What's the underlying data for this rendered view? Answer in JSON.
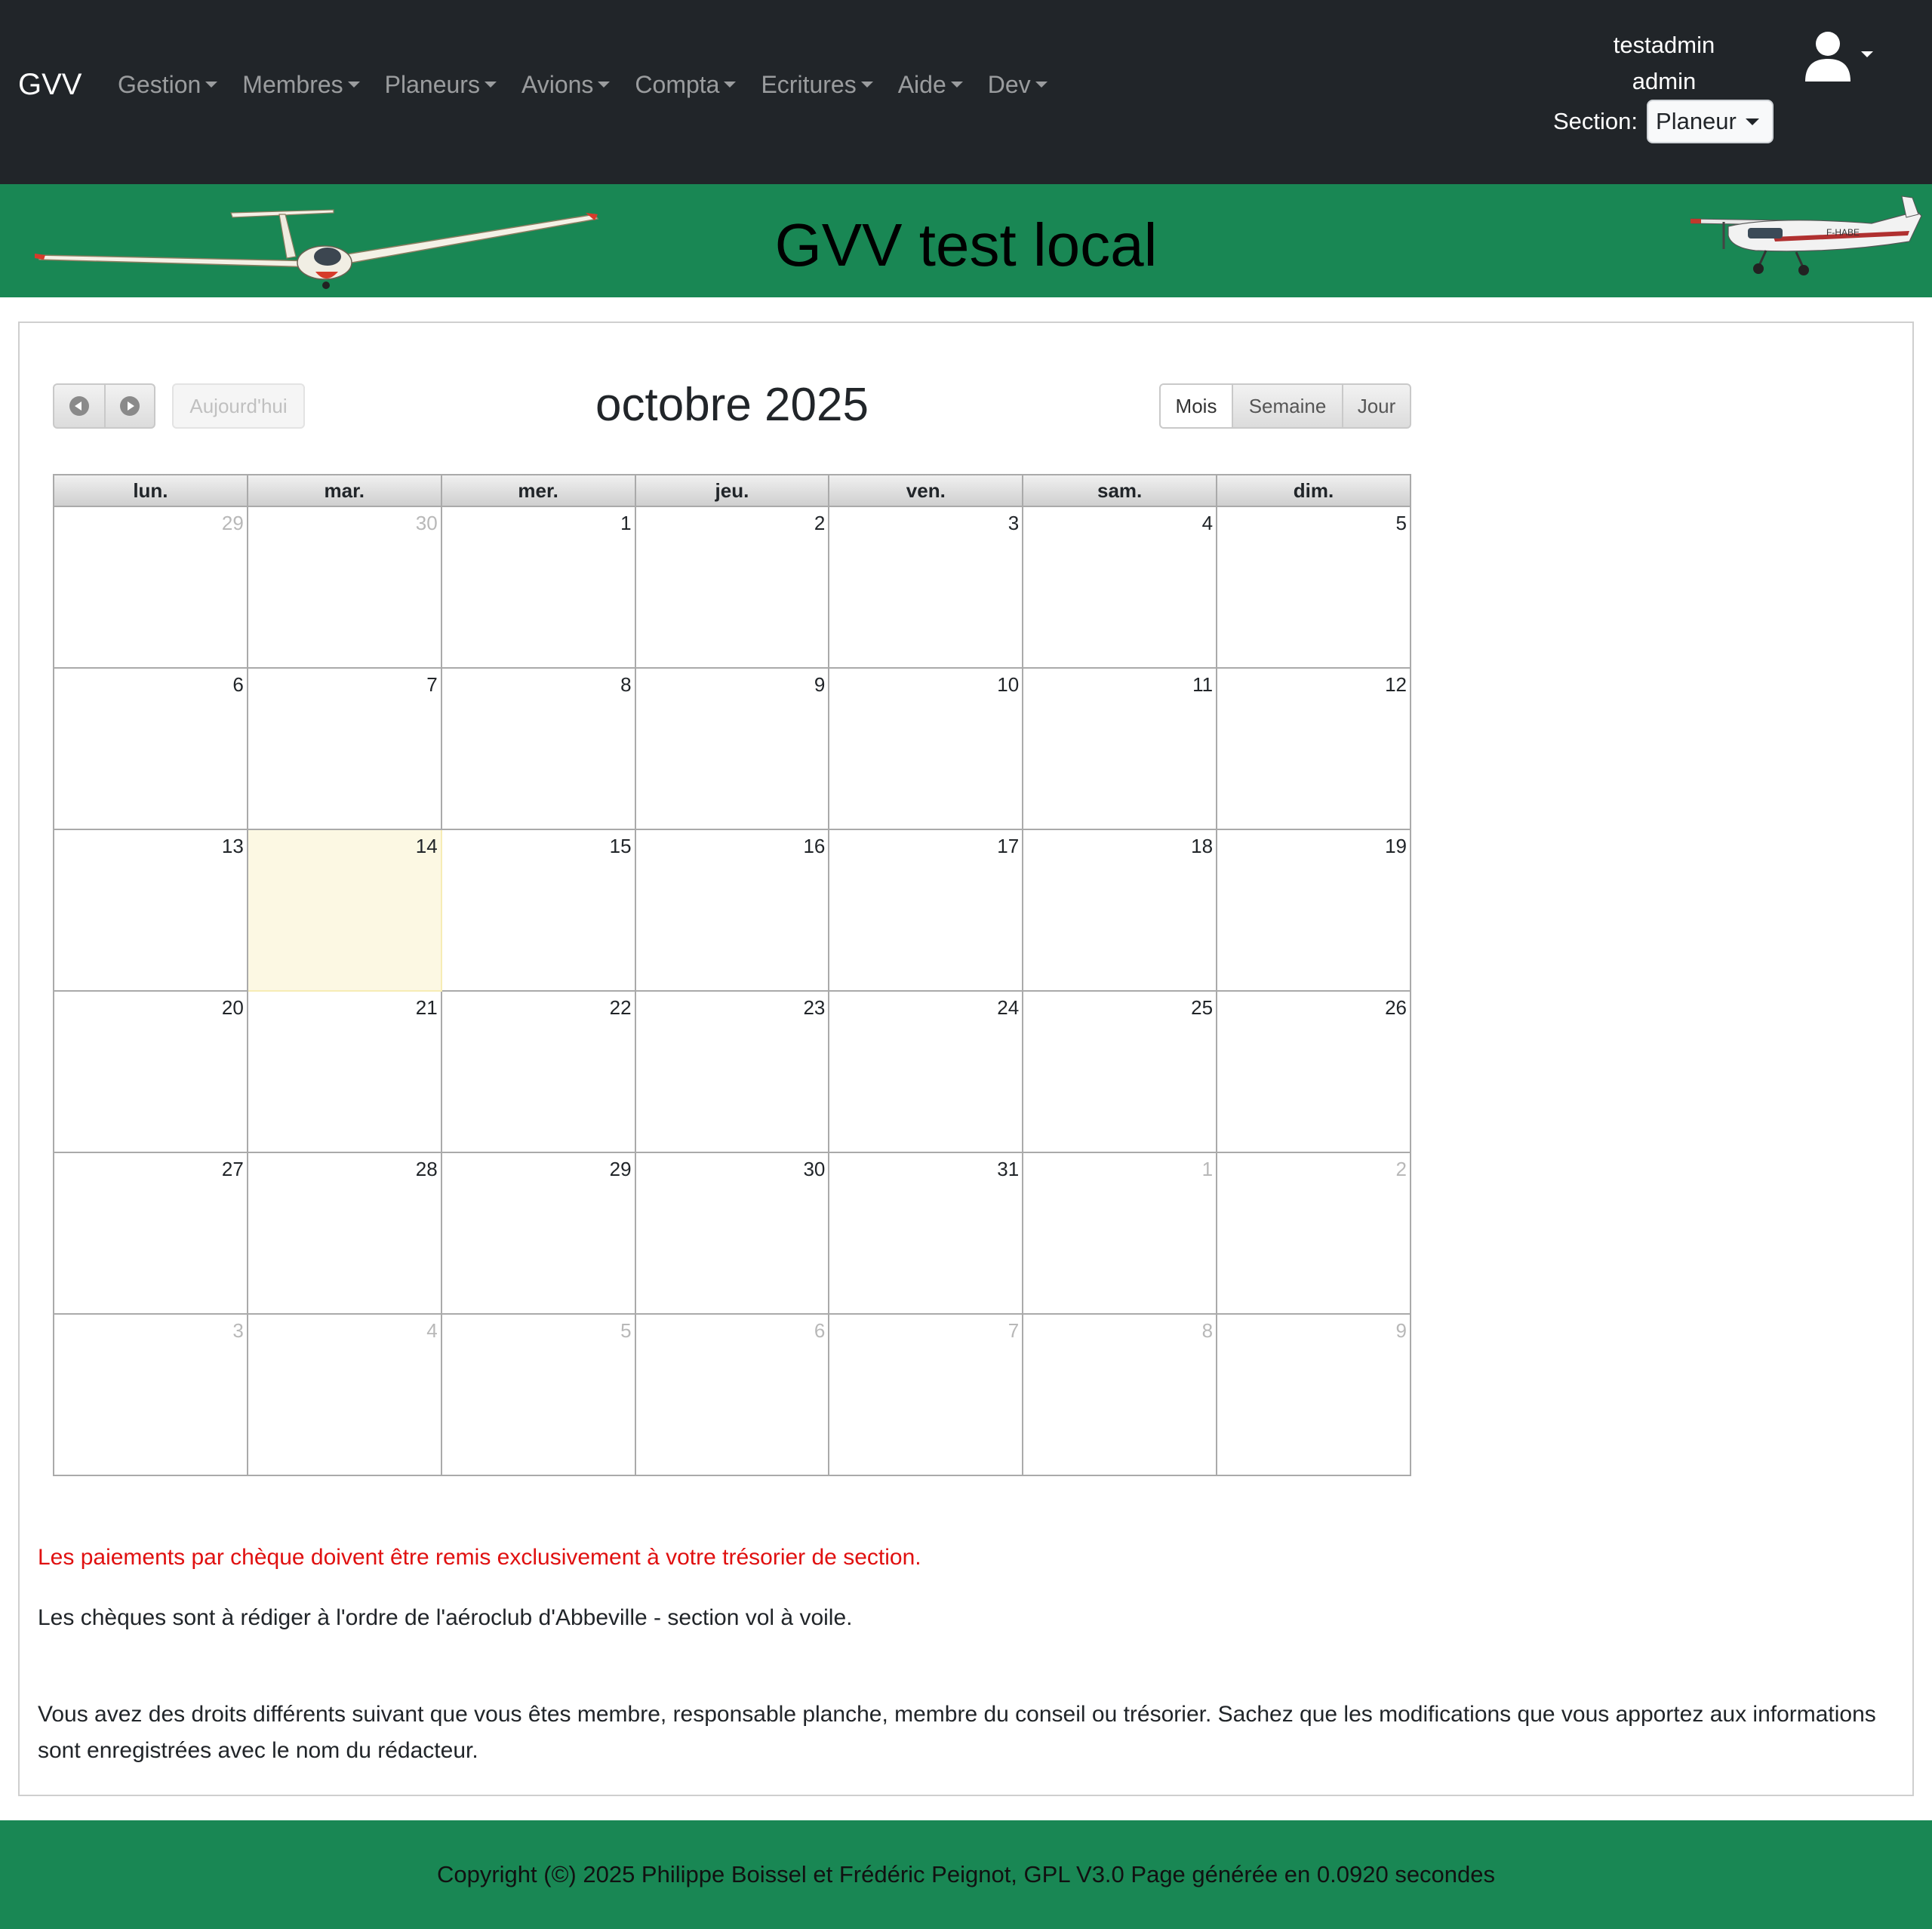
{
  "navbar": {
    "brand": "GVV",
    "menu": [
      {
        "label": "Gestion"
      },
      {
        "label": "Membres"
      },
      {
        "label": "Planeurs"
      },
      {
        "label": "Avions"
      },
      {
        "label": "Compta"
      },
      {
        "label": "Ecritures"
      },
      {
        "label": "Aide"
      },
      {
        "label": "Dev"
      }
    ],
    "user": {
      "login": "testadmin",
      "role": "admin",
      "icon": "user-icon"
    },
    "section": {
      "label": "Section:",
      "selected": "Planeur"
    }
  },
  "banner": {
    "title": "GVV test local",
    "left_image": "glider",
    "right_image": "cessna-airplane",
    "color": "#198754"
  },
  "calendar": {
    "title": "octobre 2025",
    "prev_icon": "chevron-left-icon",
    "next_icon": "chevron-right-icon",
    "today_label": "Aujourd'hui",
    "views": [
      {
        "label": "Mois",
        "active": true
      },
      {
        "label": "Semaine",
        "active": false
      },
      {
        "label": "Jour",
        "active": false
      }
    ],
    "weekdays": [
      "lun.",
      "mar.",
      "mer.",
      "jeu.",
      "ven.",
      "sam.",
      "dim."
    ],
    "weeks": [
      [
        {
          "d": "29",
          "other": true
        },
        {
          "d": "30",
          "other": true
        },
        {
          "d": "1"
        },
        {
          "d": "2"
        },
        {
          "d": "3"
        },
        {
          "d": "4"
        },
        {
          "d": "5"
        }
      ],
      [
        {
          "d": "6"
        },
        {
          "d": "7"
        },
        {
          "d": "8"
        },
        {
          "d": "9"
        },
        {
          "d": "10"
        },
        {
          "d": "11"
        },
        {
          "d": "12"
        }
      ],
      [
        {
          "d": "13"
        },
        {
          "d": "14",
          "today": true
        },
        {
          "d": "15"
        },
        {
          "d": "16"
        },
        {
          "d": "17"
        },
        {
          "d": "18"
        },
        {
          "d": "19"
        }
      ],
      [
        {
          "d": "20"
        },
        {
          "d": "21"
        },
        {
          "d": "22"
        },
        {
          "d": "23"
        },
        {
          "d": "24"
        },
        {
          "d": "25"
        },
        {
          "d": "26"
        }
      ],
      [
        {
          "d": "27"
        },
        {
          "d": "28"
        },
        {
          "d": "29"
        },
        {
          "d": "30"
        },
        {
          "d": "31"
        },
        {
          "d": "1",
          "other": true
        },
        {
          "d": "2",
          "other": true
        }
      ],
      [
        {
          "d": "3",
          "other": true
        },
        {
          "d": "4",
          "other": true
        },
        {
          "d": "5",
          "other": true
        },
        {
          "d": "6",
          "other": true
        },
        {
          "d": "7",
          "other": true
        },
        {
          "d": "8",
          "other": true
        },
        {
          "d": "9",
          "other": true
        }
      ]
    ]
  },
  "notes": {
    "warning": "Les paiements par chèque doivent être remis exclusivement à votre trésorier de section.",
    "cheques": "Les chèques sont à rédiger à l'ordre de l'aéroclub d'Abbeville - section vol à voile.",
    "rights": "Vous avez des droits différents suivant que vous êtes membre, responsable planche, membre du conseil ou trésorier. Sachez que les modifications que vous apportez aux informations sont enregistrées avec le nom du rédacteur."
  },
  "footer": {
    "text": "Copyright (©) 2025 Philippe Boissel et Frédéric Peignot, GPL V3.0 Page générée en 0.0920 secondes"
  },
  "colors": {
    "navbar": "#212529",
    "brand_green": "#198754",
    "warning_red": "#e01010",
    "today_highlight": "#fcf8e3"
  }
}
